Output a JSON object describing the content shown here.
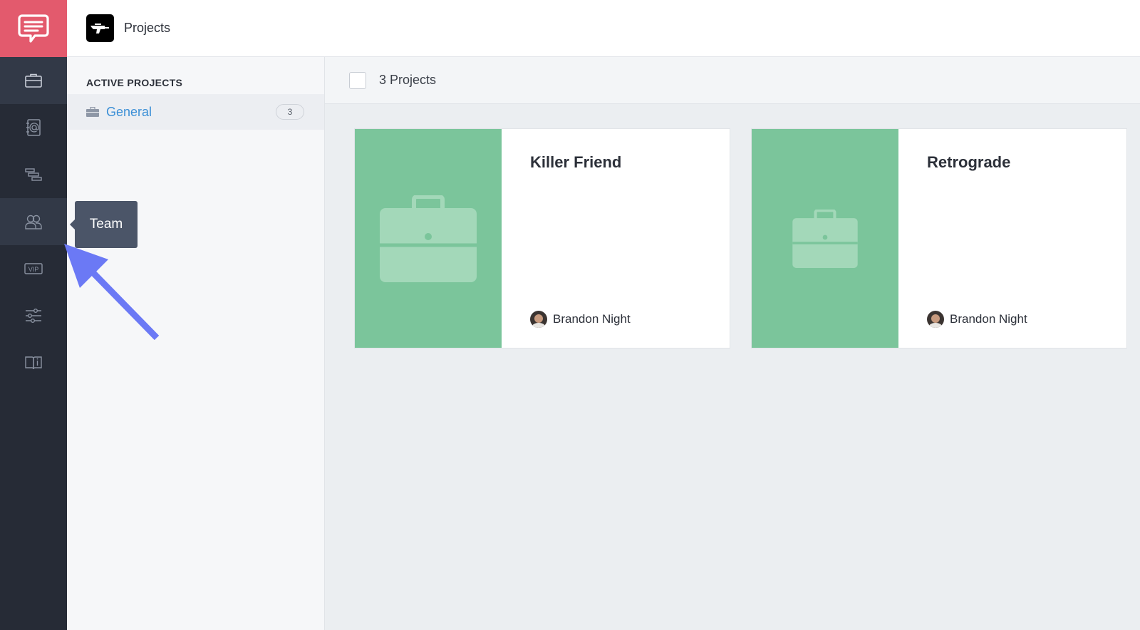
{
  "app": {
    "header": {
      "title": "Projects"
    },
    "rail": {
      "items": [
        {
          "icon": "briefcase-icon",
          "active": true
        },
        {
          "icon": "address-book-icon"
        },
        {
          "icon": "timeline-icon"
        },
        {
          "icon": "team-icon",
          "hover": true
        },
        {
          "icon": "vip-icon"
        },
        {
          "icon": "sliders-icon"
        },
        {
          "icon": "info-book-icon"
        }
      ],
      "tooltip": "Team",
      "vip_text": "VIP"
    },
    "sidebar": {
      "heading": "ACTIVE PROJECTS",
      "groups": [
        {
          "label": "General",
          "count": "3"
        }
      ]
    },
    "main": {
      "count_label": "3 Projects",
      "projects": [
        {
          "title": "Killer Friend",
          "owner": "Brandon Night"
        },
        {
          "title": "Retrograde",
          "owner": "Brandon Night"
        }
      ]
    },
    "colors": {
      "brand": "#e35a6d",
      "rail": "#262b36",
      "thumb": "#7bc59b",
      "link": "#3b8fd6",
      "annotation_arrow": "#6b79f5"
    }
  }
}
